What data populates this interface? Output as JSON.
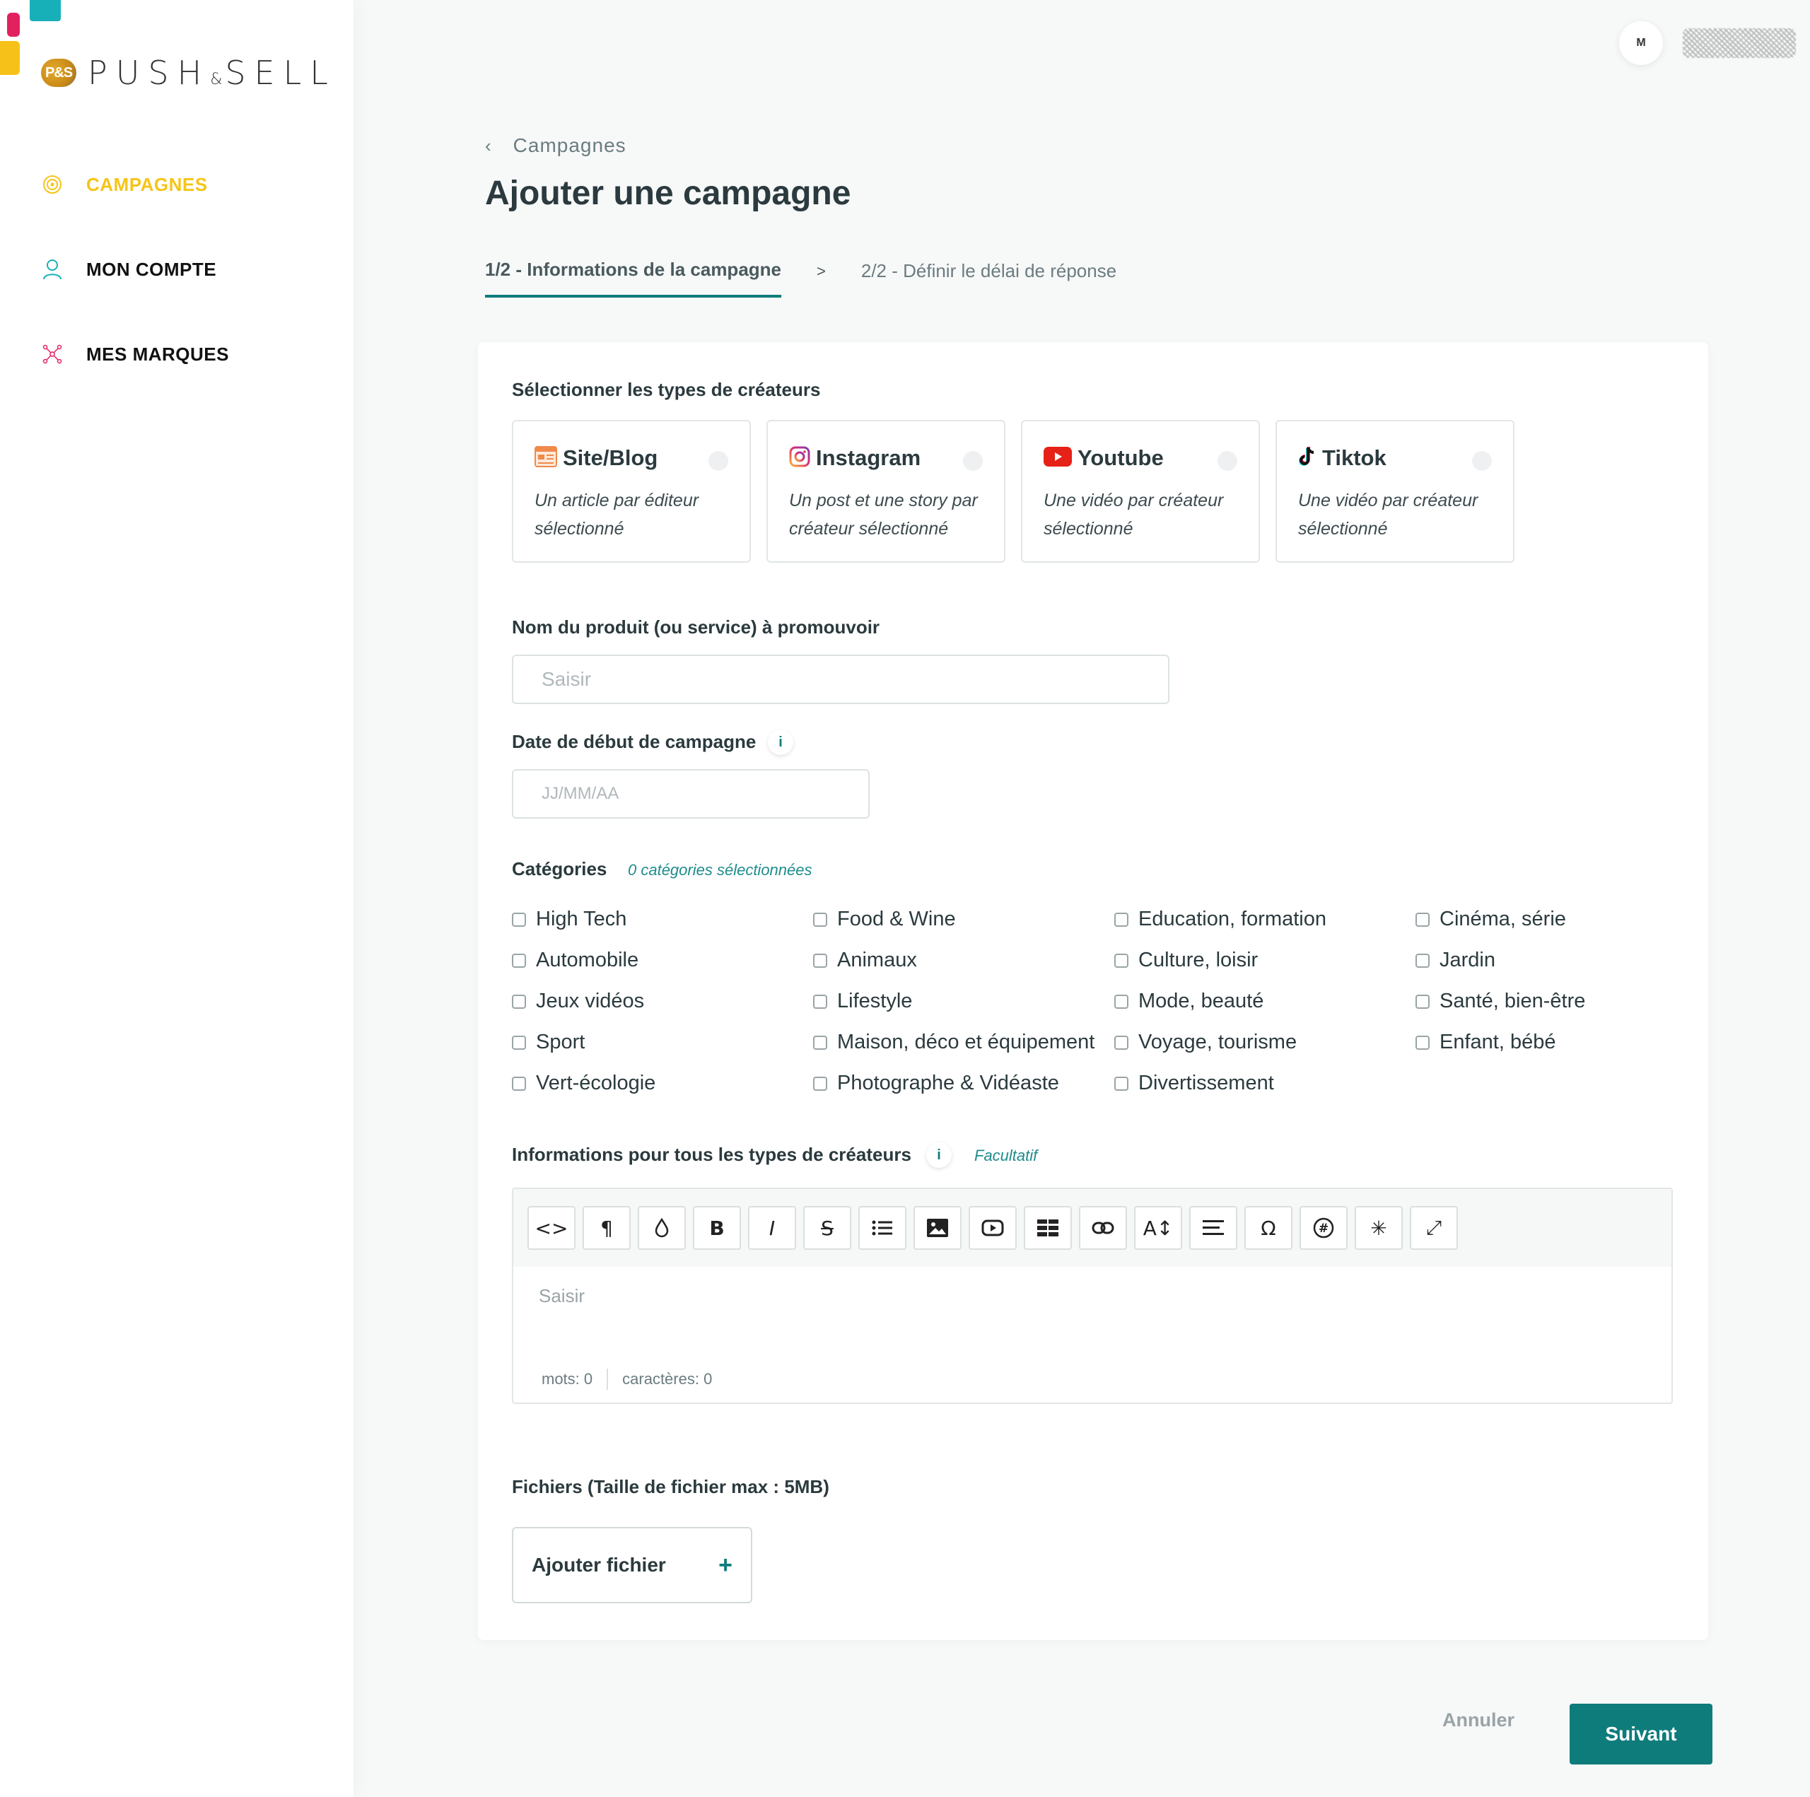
{
  "brand": {
    "badge": "P&S",
    "name_left": "PUSH",
    "amp": "&",
    "name_right": "SELL"
  },
  "colors": {
    "accent": "#0e7c7b",
    "active_nav": "#f5c518",
    "deco_teal": "#17b0b8",
    "deco_pink": "#e2215f",
    "deco_yellow": "#f6c21a"
  },
  "sidebar": {
    "items": [
      {
        "label": "CAMPAGNES",
        "icon": "target-icon",
        "active": true
      },
      {
        "label": "MON COMPTE",
        "icon": "user-icon",
        "active": false
      },
      {
        "label": "MES MARQUES",
        "icon": "network-icon",
        "active": false
      }
    ]
  },
  "user": {
    "avatar_initial": "M"
  },
  "header": {
    "breadcrumb": "Campagnes",
    "title": "Ajouter une campagne",
    "step1": "1/2 - Informations de la campagne",
    "step_separator": ">",
    "step2": "2/2 - Définir le délai de réponse"
  },
  "form": {
    "creator_types_label": "Sélectionner les types de créateurs",
    "creator_types": [
      {
        "name": "Site/Blog",
        "icon": "blog-icon",
        "desc": "Un article par éditeur sélectionné"
      },
      {
        "name": "Instagram",
        "icon": "instagram-icon",
        "desc": "Un post et une story par créateur sélectionné"
      },
      {
        "name": "Youtube",
        "icon": "youtube-icon",
        "desc": "Une vidéo par créateur sélectionné"
      },
      {
        "name": "Tiktok",
        "icon": "tiktok-icon",
        "desc": "Une vidéo par créateur sélectionné"
      }
    ],
    "product_label": "Nom du produit (ou service) à promouvoir",
    "product_placeholder": "Saisir",
    "product_value": "",
    "date_label": "Date de début de campagne",
    "date_placeholder": "JJ/MM/AA",
    "date_value": "",
    "info_glyph": "i",
    "categories_label": "Catégories",
    "categories_count": "0 catégories sélectionnées",
    "categories": [
      [
        "High Tech",
        "Automobile",
        "Jeux vidéos",
        "Sport",
        "Vert-écologie"
      ],
      [
        "Food & Wine",
        "Animaux",
        "Lifestyle",
        "Maison, déco et équipement",
        "Photographe & Vidéaste"
      ],
      [
        "Education, formation",
        "Culture, loisir",
        "Mode, beauté",
        "Voyage, tourisme",
        "Divertissement"
      ],
      [
        "Cinéma, série",
        "Jardin",
        "Santé, bien-être",
        "Enfant, bébé"
      ]
    ],
    "info_all_label": "Informations pour tous les types de créateurs",
    "info_all_optional": "Facultatif",
    "editor": {
      "toolbar": [
        {
          "name": "code-view-icon",
          "glyph": "<>"
        },
        {
          "name": "paragraph-icon",
          "glyph": "¶"
        },
        {
          "name": "color-drop-icon",
          "glyph": "💧"
        },
        {
          "name": "bold-icon",
          "glyph": "B"
        },
        {
          "name": "italic-icon",
          "glyph": "I"
        },
        {
          "name": "strikethrough-icon",
          "glyph": "S"
        },
        {
          "name": "list-icon",
          "glyph": "☰"
        },
        {
          "name": "image-icon",
          "glyph": "▣"
        },
        {
          "name": "video-icon",
          "glyph": "▶"
        },
        {
          "name": "table-icon",
          "glyph": "▦"
        },
        {
          "name": "link-icon",
          "glyph": "⊂⊃"
        },
        {
          "name": "font-size-icon",
          "glyph": "A↕"
        },
        {
          "name": "align-icon",
          "glyph": "≡"
        },
        {
          "name": "special-chars-icon",
          "glyph": "Ω"
        },
        {
          "name": "hashtag-icon",
          "glyph": "#"
        },
        {
          "name": "emoji-icon",
          "glyph": "✳"
        },
        {
          "name": "fullscreen-icon",
          "glyph": "⤢"
        }
      ],
      "placeholder": "Saisir",
      "words": "mots: 0",
      "chars": "caractères: 0"
    },
    "files_label": "Fichiers (Taille de fichier max : 5MB)",
    "add_file": "Ajouter fichier",
    "add_file_plus": "+"
  },
  "actions": {
    "cancel": "Annuler",
    "next": "Suivant"
  }
}
